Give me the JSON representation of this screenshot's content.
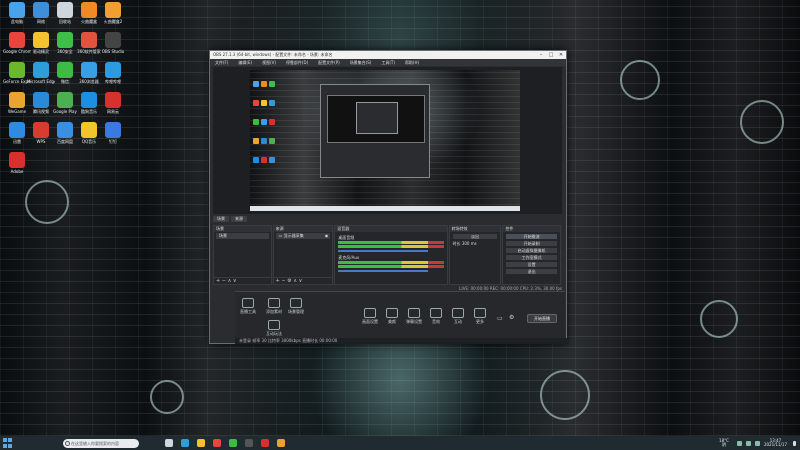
{
  "desktop_icons": [
    {
      "label": "此电脑",
      "color": "#4aa3e8"
    },
    {
      "label": "网络",
      "color": "#3f8fd8"
    },
    {
      "label": "回收站",
      "color": "#cfd6dc"
    },
    {
      "label": "火曲魔盒",
      "color": "#f08a24"
    },
    {
      "label": "火曲魔盒2",
      "color": "#f0a030"
    },
    {
      "label": "Google Chrome",
      "color": "#e8453c"
    },
    {
      "label": "驱动精灵",
      "color": "#f2c230"
    },
    {
      "label": "360安全",
      "color": "#3fbf4a"
    },
    {
      "label": "360软件管家",
      "color": "#e0533c"
    },
    {
      "label": "OBS Studio",
      "color": "#444"
    },
    {
      "label": "GeForce Experience",
      "color": "#6ab82e"
    },
    {
      "label": "Microsoft Edge",
      "color": "#2f9ed8"
    },
    {
      "label": "微信",
      "color": "#3dbb46"
    },
    {
      "label": "360浏览器",
      "color": "#39a0e6"
    },
    {
      "label": "哔哩哔哩",
      "color": "#2e9be0"
    },
    {
      "label": "WeGame",
      "color": "#e8a530"
    },
    {
      "label": "腾讯视频",
      "color": "#2a8ad8"
    },
    {
      "label": "Google Play",
      "color": "#4caf50"
    },
    {
      "label": "酷狗音乐",
      "color": "#1e8fe0"
    },
    {
      "label": "网易云",
      "color": "#d8302f"
    },
    {
      "label": "迅雷",
      "color": "#2f8ae0"
    },
    {
      "label": "WPS",
      "color": "#d83b2f"
    },
    {
      "label": "百度网盘",
      "color": "#3a8fe0"
    },
    {
      "label": "QQ音乐",
      "color": "#f2c52a"
    },
    {
      "label": "钉钉",
      "color": "#3a7ae0"
    },
    {
      "label": "Adobe",
      "color": "#d8302f"
    }
  ],
  "obs": {
    "title": "OBS 27.1.3 (64-bit, windows) - 配置文件: 未命名 - 场景: 未命名",
    "menu": [
      "文件(F)",
      "编辑(E)",
      "视图(V)",
      "停靠部件(D)",
      "配置文件(P)",
      "场景集合(S)",
      "工具(T)",
      "帮助(H)"
    ],
    "tabs": [
      "场景",
      "来源"
    ],
    "scenes_header": "场景",
    "scenes": [
      "场景"
    ],
    "sources_header": "来源",
    "sources": [
      "显示器采集"
    ],
    "mixer_header": "混音器",
    "mixer": [
      {
        "name": "桌面音频"
      },
      {
        "name": "麦克风/Aux"
      }
    ],
    "transitions_header": "转场特效",
    "transition_value": "淡出",
    "duration_label": "时长",
    "duration_value": "300 ms",
    "controls_header": "控件",
    "controls": [
      "开始推流",
      "开始录制",
      "启动虚拟摄像机",
      "工作室模式",
      "设置",
      "退出"
    ],
    "status": "LIVE: 00:00:00   REC: 00:00:00   CPU: 2.3%, 30.00 fps"
  },
  "bottom_panel": {
    "left_tools": [
      "直播工具",
      "添加素材",
      "场景管理",
      "互动玩法"
    ],
    "tools": [
      "画面设置",
      "美颜",
      "弹幕设置",
      "音效",
      "互动",
      "更多"
    ],
    "golive": "开始直播",
    "status_text": "未登录   帧率 30   比特率 3000kbps   直播时长 00:00:00"
  },
  "taskbar": {
    "search_placeholder": "在这里输入你要搜索的内容",
    "weather": "18°C",
    "weather_sub": "阴",
    "time": "13:47",
    "date": "2021/11/17",
    "apps": [
      {
        "name": "task-view",
        "color": "#cfd6dc"
      },
      {
        "name": "edge",
        "color": "#2f9ed8"
      },
      {
        "name": "explorer",
        "color": "#f2c230"
      },
      {
        "name": "chrome",
        "color": "#e8453c"
      },
      {
        "name": "wechat",
        "color": "#3dbb46"
      },
      {
        "name": "obs",
        "color": "#555"
      },
      {
        "name": "photo",
        "color": "#d8302f"
      },
      {
        "name": "folder",
        "color": "#f0a030"
      }
    ]
  }
}
